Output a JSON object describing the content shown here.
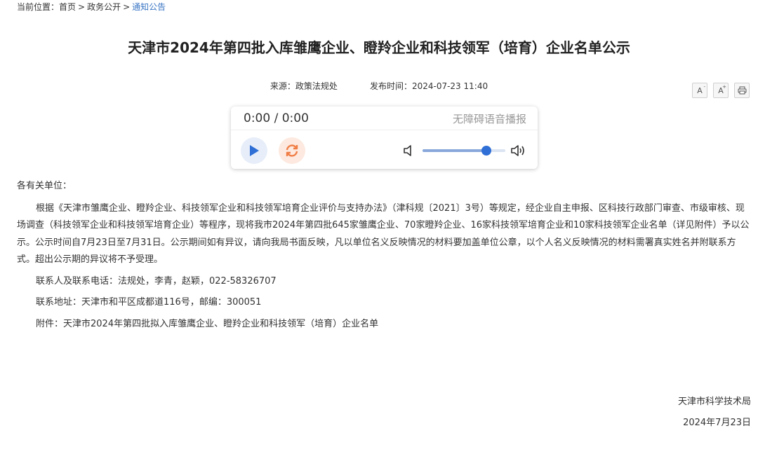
{
  "breadcrumb": {
    "prefix": "当前位置：",
    "items": [
      "首页",
      "政务公开",
      "通知公告"
    ],
    "separator": ">"
  },
  "article": {
    "title": "天津市2024年第四批入库雏鹰企业、瞪羚企业和科技领军（培育）企业名单公示",
    "source_label": "来源：",
    "source": "政策法规处",
    "publish_label": "发布时间：",
    "publish_time": "2024-07-23 11:40"
  },
  "tools": {
    "font_decrease": "A",
    "font_increase": "A",
    "decrease_mark": "-",
    "increase_mark": "+",
    "print_icon": "printer-icon"
  },
  "player": {
    "time": "0:00 / 0:00",
    "label": "无障碍语音播报",
    "volume": 0.77,
    "play_icon": "play-icon",
    "loop_icon": "refresh-icon",
    "accent": "#2f6fd6",
    "loop_color": "#f07d45"
  },
  "body": {
    "greeting": "各有关单位：",
    "paragraph": "根据《天津市雏鹰企业、瞪羚企业、科技领军企业和科技领军培育企业评价与支持办法》（津科规〔2021〕3号）等规定，经企业自主申报、区科技行政部门审查、市级审核、现场调查（科技领军企业和科技领军培育企业）等程序，现将我市2024年第四批645家雏鹰企业、70家瞪羚企业、16家科技领军培育企业和10家科技领军企业名单（详见附件）予以公示。公示时间自7月23日至7月31日。公示期间如有异议，请向我局书面反映，凡以单位名义反映情况的材料要加盖单位公章，以个人名义反映情况的材料需署真实姓名并附联系方式。超出公示期的异议将不予受理。",
    "contact": "联系人及联系电话：法规处，李青，赵颖，022-58326707",
    "address": "联系地址：天津市和平区成都道116号，邮编：300051",
    "attachment": "附件：天津市2024年第四批拟入库雏鹰企业、瞪羚企业和科技领军（培育）企业名单"
  },
  "signature": {
    "org": "天津市科学技术局",
    "date": "2024年7月23日"
  }
}
